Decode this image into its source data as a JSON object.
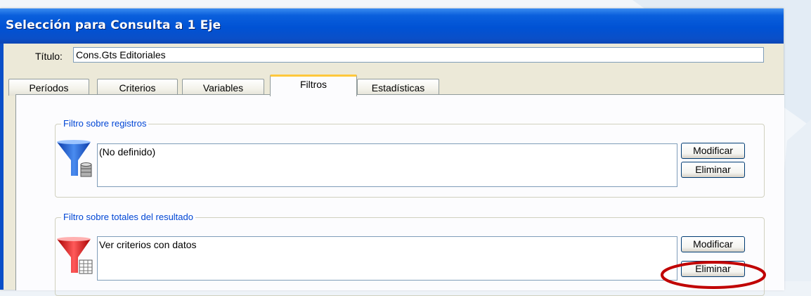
{
  "window": {
    "title": "Selección para Consulta a 1 Eje"
  },
  "title_field": {
    "label": "Título:",
    "value": "Cons.Gts Editoriales"
  },
  "tabs": [
    {
      "label": "Períodos",
      "active": false
    },
    {
      "label": "Criterios",
      "active": false
    },
    {
      "label": "Variables",
      "active": false
    },
    {
      "label": "Filtros",
      "active": true
    },
    {
      "label": "Estadísticas",
      "active": false
    }
  ],
  "record_filter": {
    "legend": "Filtro sobre registros",
    "icon": "funnel-database-icon",
    "value": "(No definido)",
    "modify_label": "Modificar",
    "delete_label": "Eliminar"
  },
  "total_filter": {
    "legend": "Filtro sobre totales del resultado",
    "icon": "funnel-table-icon",
    "value": "Ver criterios con datos",
    "modify_label": "Modificar",
    "delete_label": "Eliminar"
  },
  "colors": {
    "titlebar": "#0052d4",
    "active_tab_accent": "#ffc83c",
    "legend_text": "#0046d5",
    "highlight_ellipse": "#c00000"
  }
}
